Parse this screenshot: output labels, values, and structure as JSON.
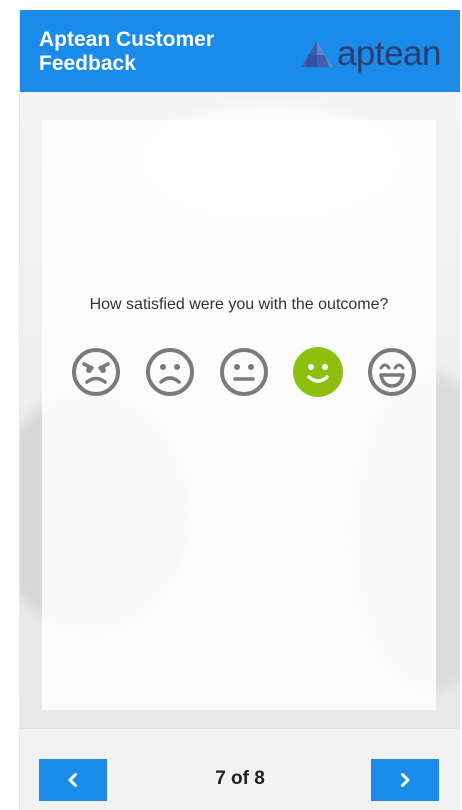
{
  "header": {
    "title": "Aptean Customer Feedback",
    "logo_text": "aptean"
  },
  "survey": {
    "question": "How satisfied were you with the outcome?",
    "selected_index": 3,
    "options": [
      {
        "icon": "angry-face-icon"
      },
      {
        "icon": "frowning-face-icon"
      },
      {
        "icon": "neutral-face-icon"
      },
      {
        "icon": "smiling-face-icon"
      },
      {
        "icon": "grinning-face-icon"
      }
    ]
  },
  "pagination": {
    "indicator": "7 of 8",
    "prev_icon": "chevron-left-icon",
    "next_icon": "chevron-right-icon"
  },
  "colors": {
    "header_bg": "#1a8be8",
    "selected_face": "#8dc00c",
    "unselected_face": "#7a7a7a",
    "button_bg": "#1a8be8"
  }
}
